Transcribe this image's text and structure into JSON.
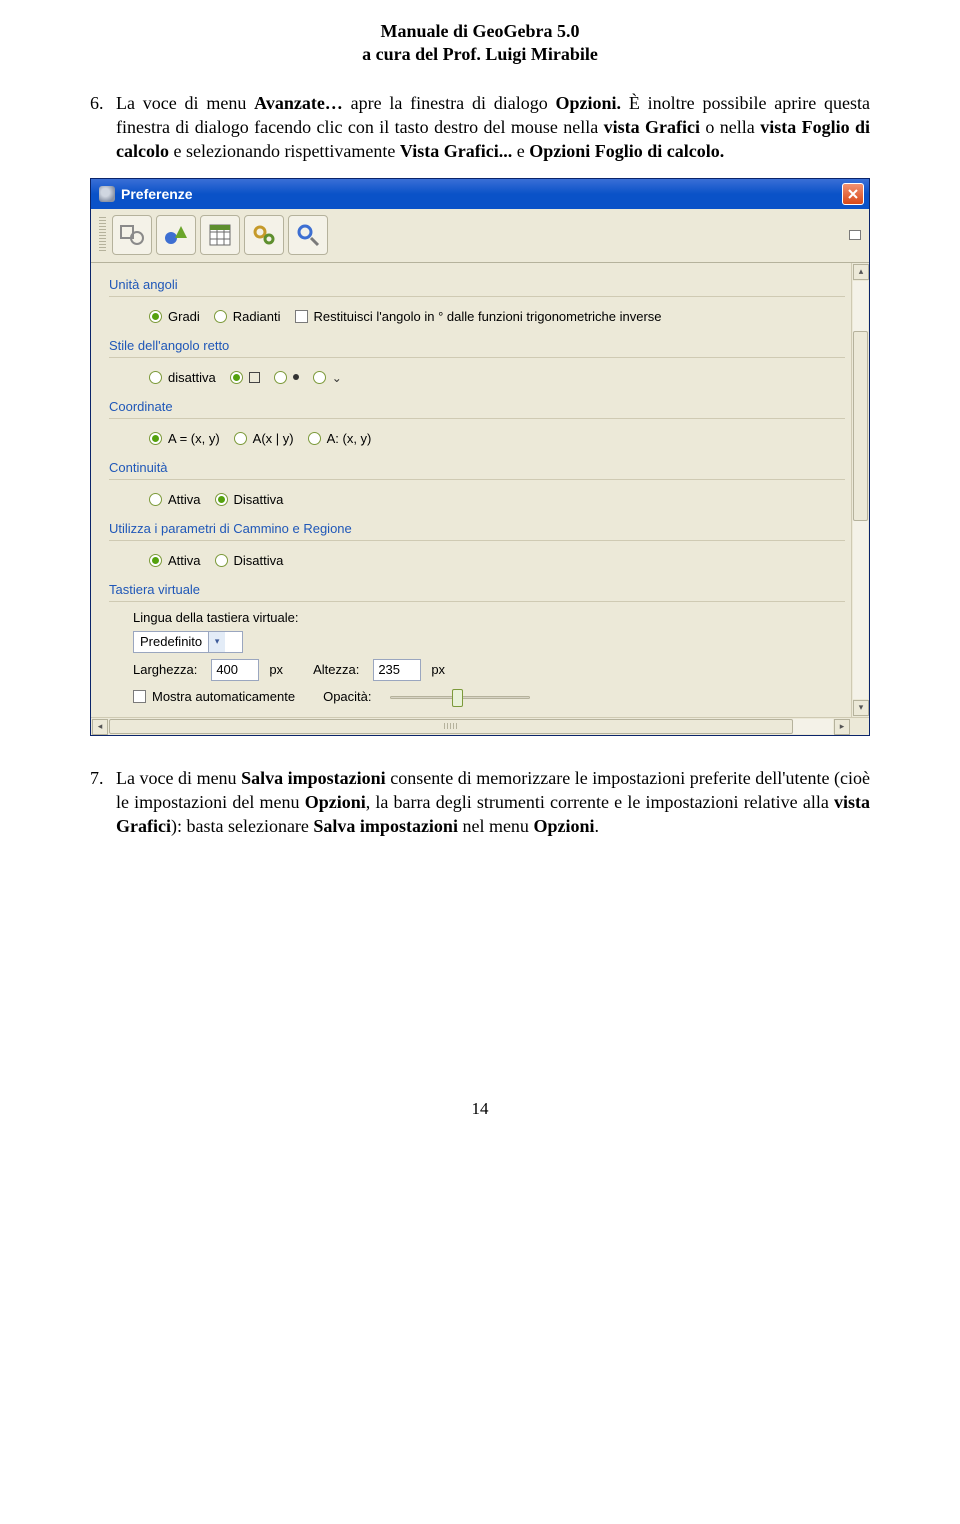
{
  "doc": {
    "header_line1": "Manuale di GeoGebra 5.0",
    "header_line2": "a cura del Prof. Luigi Mirabile",
    "para6_num": "6.",
    "para6_pre": "La voce di menu ",
    "para6_b1": "Avanzate…",
    "para6_mid": " apre la finestra di dialogo ",
    "para6_b2": "Opzioni.",
    "para6_tail_1": " È inoltre possibile aprire questa finestra di dialogo facendo clic con il tasto destro del mouse nella ",
    "para6_b3": "vista Grafici",
    "para6_tail_2": " o nella ",
    "para6_b4": "vista Foglio di calcolo",
    "para6_tail_3": " e selezionando rispettivamente ",
    "para6_b5": "Vista Grafici...",
    "para6_tail_4": " e ",
    "para6_b6": "Opzioni Foglio di calcolo.",
    "para7_num": "7.",
    "para7_pre": "La voce di menu ",
    "para7_b1": "Salva impostazioni",
    "para7_mid1": " consente di memorizzare le impostazioni preferite dell'utente (cioè le impostazioni del menu ",
    "para7_b2": "Opzioni",
    "para7_mid2": ", la barra degli strumenti corrente e le impostazioni relative alla ",
    "para7_b3": "vista Grafici",
    "para7_mid3": "): basta selezionare ",
    "para7_b4": "Salva impostazioni",
    "para7_mid4": " nel menu ",
    "para7_b5": "Opzioni",
    "para7_end": ".",
    "page_number": "14"
  },
  "dialog": {
    "title": "Preferenze",
    "sections": {
      "angle_units": {
        "label": "Unità angoli",
        "opt_gradi": "Gradi",
        "opt_radianti": "Radianti",
        "checkbox_label": "Restituisci l'angolo in ° dalle funzioni trigonometriche inverse"
      },
      "right_angle": {
        "label": "Stile dell'angolo retto",
        "opt_off": "disattiva"
      },
      "coordinates": {
        "label": "Coordinate",
        "opt1": "A = (x, y)",
        "opt2": "A(x | y)",
        "opt3": "A: (x, y)"
      },
      "continuity": {
        "label": "Continuità",
        "on": "Attiva",
        "off": "Disattiva"
      },
      "path_region": {
        "label": "Utilizza i parametri di Cammino e Regione",
        "on": "Attiva",
        "off": "Disattiva"
      },
      "vkbd": {
        "label": "Tastiera virtuale",
        "lang_label": "Lingua della tastiera virtuale:",
        "lang_value": "Predefinito",
        "width_label": "Larghezza:",
        "width_value": "400",
        "height_label": "Altezza:",
        "height_value": "235",
        "px": "px",
        "auto_show": "Mostra automaticamente",
        "opacity": "Opacità:"
      }
    }
  }
}
